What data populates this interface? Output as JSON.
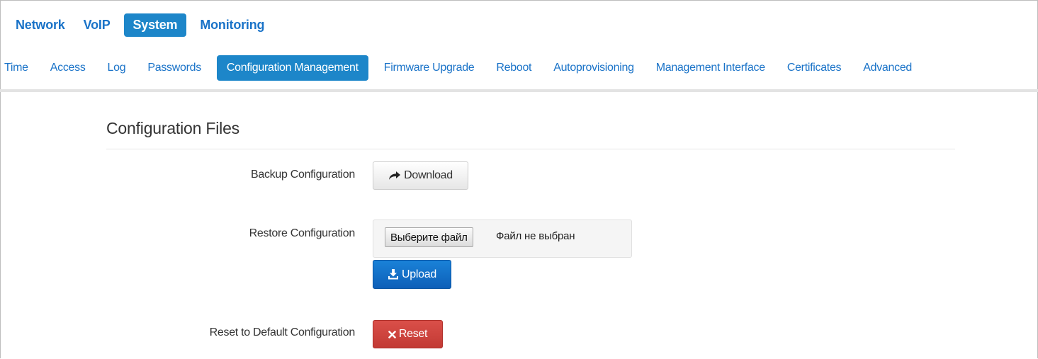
{
  "top_nav": {
    "items": [
      {
        "label": "Network",
        "active": false
      },
      {
        "label": "VoIP",
        "active": false
      },
      {
        "label": "System",
        "active": true
      },
      {
        "label": "Monitoring",
        "active": false
      }
    ]
  },
  "sub_nav": {
    "items": [
      {
        "label": "Time",
        "active": false
      },
      {
        "label": "Access",
        "active": false
      },
      {
        "label": "Log",
        "active": false
      },
      {
        "label": "Passwords",
        "active": false
      },
      {
        "label": "Configuration Management",
        "active": true
      },
      {
        "label": "Firmware Upgrade",
        "active": false
      },
      {
        "label": "Reboot",
        "active": false
      },
      {
        "label": "Autoprovisioning",
        "active": false
      },
      {
        "label": "Management Interface",
        "active": false
      },
      {
        "label": "Certificates",
        "active": false
      },
      {
        "label": "Advanced",
        "active": false
      }
    ]
  },
  "section": {
    "title": "Configuration Files"
  },
  "backup": {
    "label": "Backup Configuration",
    "button_label": "Download",
    "button_icon": "share-arrow-icon"
  },
  "restore": {
    "label": "Restore Configuration",
    "file_button_label": "Выберите файл",
    "file_status": "Файл не выбран",
    "upload_label": "Upload",
    "upload_icon": "download-tray-icon"
  },
  "reset": {
    "label": "Reset to Default Configuration",
    "button_label": "Reset",
    "button_icon": "close-x-icon"
  },
  "colors": {
    "accent": "#1d86c9",
    "primary": "#0d6ac6",
    "danger": "#d2443e"
  }
}
